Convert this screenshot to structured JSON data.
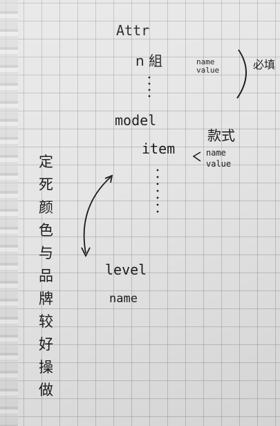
{
  "note": {
    "attr": "Attr",
    "n_group": "n 組",
    "nv1_name": "name",
    "nv1_value": "value",
    "required": "必填",
    "model": "model",
    "style": "款式",
    "item": "item",
    "nv2_name": "name",
    "nv2_value": "value",
    "level": "level",
    "level_name": "name",
    "side_chars": [
      "定",
      "死",
      "颜",
      "色",
      "与",
      "品",
      "牌",
      "较",
      "好",
      "操",
      "做"
    ]
  }
}
